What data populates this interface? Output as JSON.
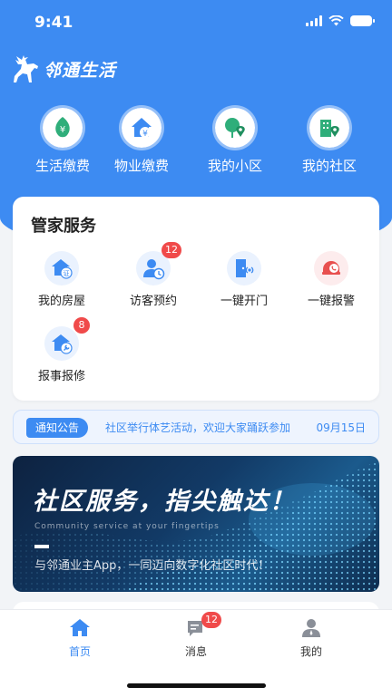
{
  "status_bar": {
    "time": "9:41"
  },
  "app": {
    "name": "邻通生活"
  },
  "top_menu": [
    {
      "label": "生活缴费",
      "icon": "leaf-yen-icon"
    },
    {
      "label": "物业缴费",
      "icon": "house-yen-icon"
    },
    {
      "label": "我的小区",
      "icon": "tree-location-icon"
    },
    {
      "label": "我的社区",
      "icon": "building-location-icon"
    }
  ],
  "steward": {
    "title": "管家服务",
    "items": [
      {
        "label": "我的房屋",
        "icon": "house-certificate-icon",
        "badge": ""
      },
      {
        "label": "访客预约",
        "icon": "visitor-clock-icon",
        "badge": "12"
      },
      {
        "label": "一键开门",
        "icon": "door-signal-icon",
        "badge": ""
      },
      {
        "label": "一键报警",
        "icon": "alarm-phone-icon",
        "badge": ""
      },
      {
        "label": "报事报修",
        "icon": "house-wrench-icon",
        "badge": "8"
      }
    ]
  },
  "notice": {
    "tag": "通知公告",
    "text": "社区举行体艺活动，欢迎大家踊跃参加",
    "date": "09月15日"
  },
  "banner": {
    "title": "社区服务，指尖触达！",
    "subtitle_en": "Community service at your fingertips",
    "subtitle": "与邻通业主App，一同迈向数字化社区时代！"
  },
  "tab_bar": {
    "tabs": [
      {
        "label": "首页",
        "icon": "home-icon",
        "active": true,
        "badge": ""
      },
      {
        "label": "消息",
        "icon": "message-icon",
        "active": false,
        "badge": "12"
      },
      {
        "label": "我的",
        "icon": "profile-icon",
        "active": false,
        "badge": ""
      }
    ]
  },
  "colors": {
    "primary": "#3d8bf2",
    "badge": "#f04a4a",
    "alarm": "#e8504f",
    "page_bg": "#f2f4f7"
  }
}
